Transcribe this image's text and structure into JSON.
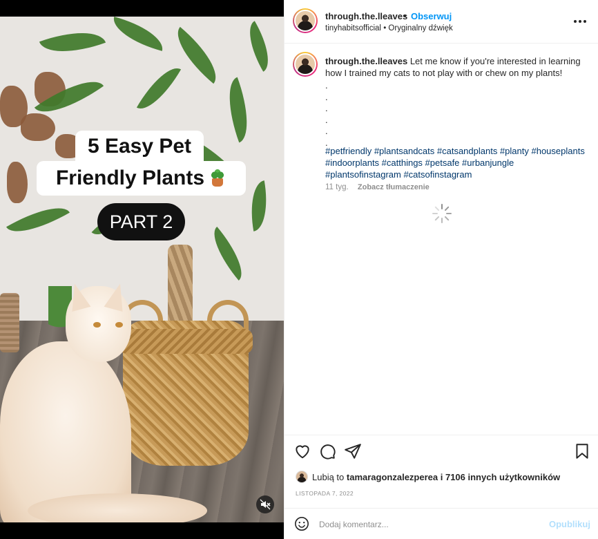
{
  "video": {
    "title_line1": "5 Easy Pet",
    "title_line2": "Friendly Plants",
    "title_emoji": "potted-plant-emoji",
    "part_label": "PART 2",
    "muted": true
  },
  "header": {
    "username": "through.the.lleaves",
    "separator": "•",
    "follow_label": "Obserwuj",
    "audio_artist": "tinyhabitsofficial",
    "audio_separator": "•",
    "audio_label": "Oryginalny dźwięk"
  },
  "caption": {
    "username": "through.the.lleaves",
    "text": "Let me know if you're interested in learning how I trained my cats to not play with or chew on my plants!",
    "dots": [
      ".",
      ".",
      ".",
      ".",
      ".",
      "."
    ],
    "hashtags_line1": "#petfriendly #plantsandcats #catsandplants #planty #houseplants",
    "hashtags_line2": "#indoorplants #catthings #petsafe #urbanjungle",
    "hashtags_line3": "#plantsofinstagram #catsofinstagram",
    "age": "11 tyg.",
    "translate_label": "Zobacz tłumaczenie"
  },
  "actions": {
    "icons": [
      "heart-icon",
      "comment-icon",
      "share-icon",
      "bookmark-icon"
    ]
  },
  "likes": {
    "prefix": "Lubią to",
    "user": "tamaragonzalezperea",
    "suffix": "i 7106 innych użytkowników"
  },
  "date": "LISTOPADA 7, 2022",
  "comment": {
    "placeholder": "Dodaj komentarz...",
    "post_label": "Opublikuj"
  },
  "colors": {
    "link_blue": "#0095f6",
    "hashtag_blue": "#00376b",
    "muted_gray": "#8e8e8e",
    "post_disabled": "#b2dffc"
  }
}
